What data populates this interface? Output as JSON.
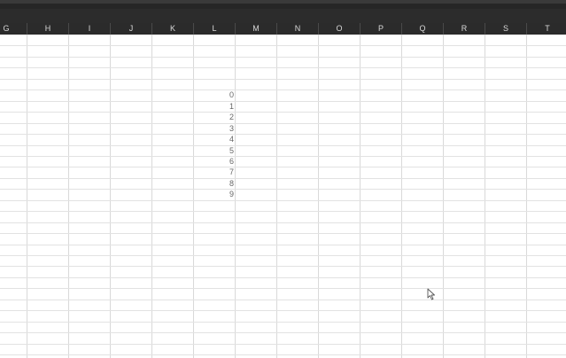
{
  "columns": [
    "G",
    "H",
    "I",
    "J",
    "K",
    "L",
    "M",
    "N",
    "O",
    "P",
    "Q",
    "R",
    "S",
    "T"
  ],
  "cells": {
    "L": [
      "0",
      "1",
      "2",
      "3",
      "4",
      "5",
      "6",
      "7",
      "8",
      "9"
    ]
  },
  "icons": {
    "cursor": "mouse-pointer-icon"
  }
}
